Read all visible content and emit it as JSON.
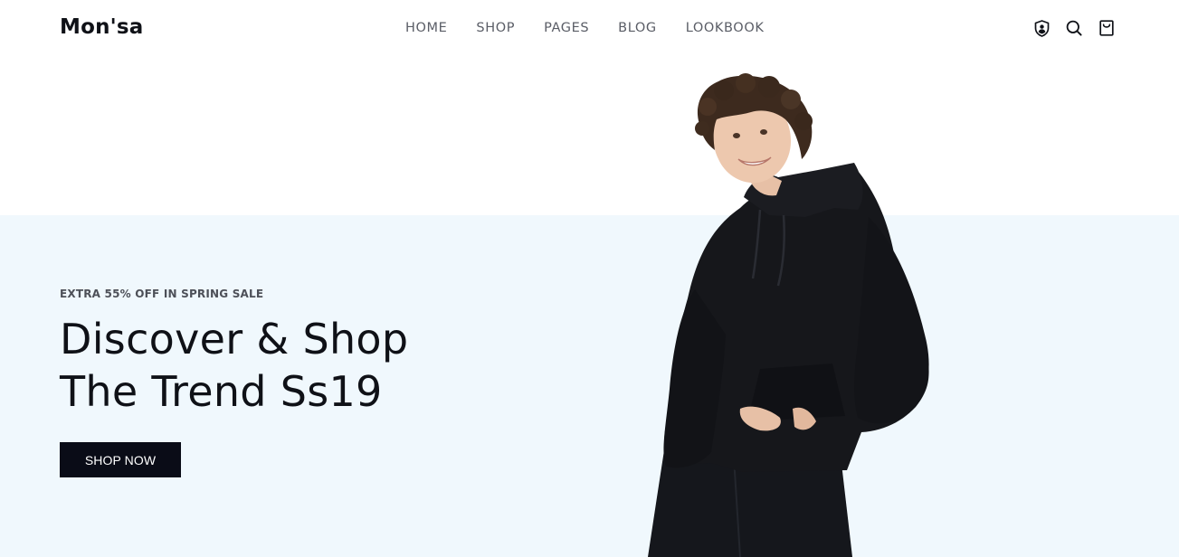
{
  "brand": {
    "logo": "Mon'sa"
  },
  "nav": {
    "items": [
      "HOME",
      "SHOP",
      "PAGES",
      "BLOG",
      "LOOKBOOK"
    ]
  },
  "header_icons": [
    "account-shield-icon",
    "search-icon",
    "shopping-bag-icon"
  ],
  "hero": {
    "eyebrow": "EXTRA 55% OFF IN SPRING SALE",
    "title_line1": "Discover & Shop",
    "title_line2": "The Trend Ss19",
    "cta_label": "SHOP NOW",
    "background_color": "#f0f8fd",
    "model_image": "model-in-black-hoodie"
  },
  "colors": {
    "text_dark": "#0f1117",
    "nav_gray": "#5a5d66",
    "button_bg": "#0a0c17"
  }
}
